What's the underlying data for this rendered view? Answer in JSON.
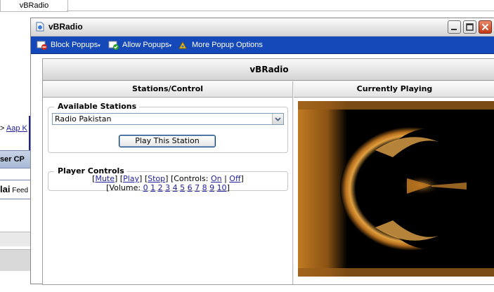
{
  "background": {
    "tab_label": "vBRadio",
    "crumb_prefix": "> ",
    "crumb_link": "Aap K",
    "user_cp": "ser CP",
    "feed_bold": "lai",
    "feed_text": " Feed"
  },
  "window": {
    "title": "vBRadio"
  },
  "popup_toolbar": {
    "block": "Block Popups",
    "allow": "Allow Popups",
    "more": "More Popup Options"
  },
  "app": {
    "title": "vBRadio",
    "col_left": "Stations/Control",
    "col_right": "Currently Playing",
    "stations_legend": "Available Stations",
    "selected_station": "Radio Pakistan",
    "play_button": "Play This Station",
    "controls_legend": "Player Controls",
    "mute": "Mute",
    "play": "Play",
    "stop": "Stop",
    "controls_label": "Controls:",
    "on": "On",
    "off": "Off",
    "volume_label": "Volume:",
    "volume_levels": [
      "0",
      "1",
      "2",
      "3",
      "4",
      "5",
      "6",
      "7",
      "8",
      "9",
      "10"
    ]
  },
  "colors": {
    "toolbar_bg": "#1548b8",
    "link": "#22229c",
    "viz_orange": "#d4912c"
  }
}
